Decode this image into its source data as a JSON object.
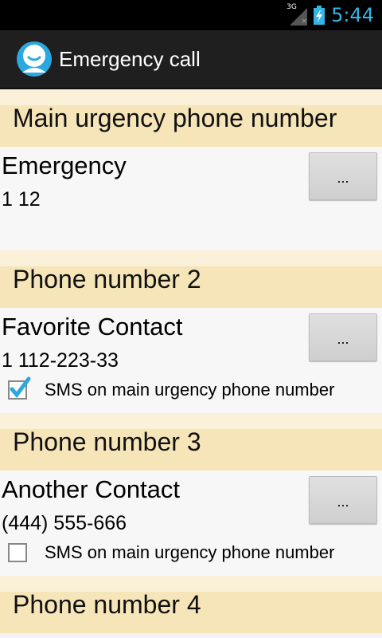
{
  "status_bar": {
    "time": "5:44",
    "network": "3G"
  },
  "app": {
    "title": "Emergency call"
  },
  "sections": [
    {
      "header": "Main urgency phone number",
      "contact_name": "Emergency",
      "number": "1 12",
      "button": "...",
      "has_sms": false
    },
    {
      "header": "Phone number 2",
      "contact_name": "Favorite Contact",
      "number": "1 112-223-33",
      "button": "...",
      "has_sms": true,
      "sms_label": "SMS on main urgency phone number",
      "sms_checked": true
    },
    {
      "header": "Phone number 3",
      "contact_name": "Another Contact",
      "number": "(444) 555-666",
      "button": "...",
      "has_sms": true,
      "sms_label": "SMS on main urgency phone number",
      "sms_checked": false
    },
    {
      "header": "Phone number 4"
    }
  ],
  "colors": {
    "accent": "#33b5e5",
    "header_bg": "#f5e5b8",
    "checkmark": "#2aa8e0"
  }
}
